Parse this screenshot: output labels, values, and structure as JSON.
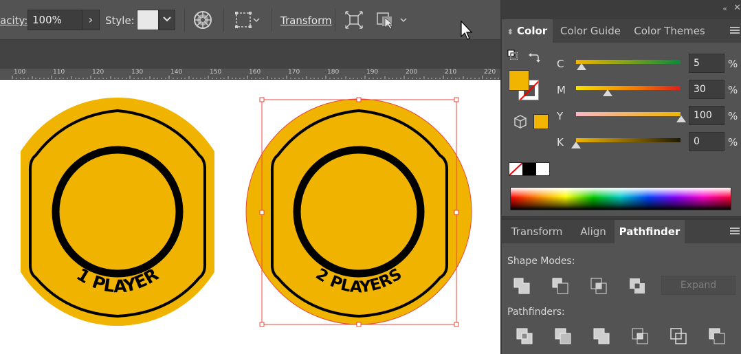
{
  "toolbar": {
    "opacity_label": "acity:",
    "opacity_value": "100%",
    "style_label": "Style:",
    "transform_label": "Transform"
  },
  "ruler": {
    "ticks": [
      "100",
      "110",
      "120",
      "130",
      "140",
      "150",
      "160",
      "170",
      "180",
      "190",
      "200",
      "210",
      "220"
    ]
  },
  "canvas": {
    "badge_left_text": "1 PLAYER",
    "badge_right_text": "2 PLAYERS",
    "badge_fill": "#f0b400",
    "selection_color": "#e8473c"
  },
  "color_panel": {
    "tabs": [
      "Color",
      "Color Guide",
      "Color Themes"
    ],
    "active_tab": "Color",
    "fill_color": "#f1b500",
    "channels": [
      {
        "name": "C",
        "value": "5",
        "unit": "%"
      },
      {
        "name": "M",
        "value": "30",
        "unit": "%"
      },
      {
        "name": "Y",
        "value": "100",
        "unit": "%"
      },
      {
        "name": "K",
        "value": "0",
        "unit": "%"
      }
    ]
  },
  "pathfinder_panel": {
    "tabs": [
      "Transform",
      "Align",
      "Pathfinder"
    ],
    "active_tab": "Pathfinder",
    "shape_modes_label": "Shape Modes:",
    "pathfinders_label": "Pathfinders:",
    "expand_label": "Expand"
  }
}
